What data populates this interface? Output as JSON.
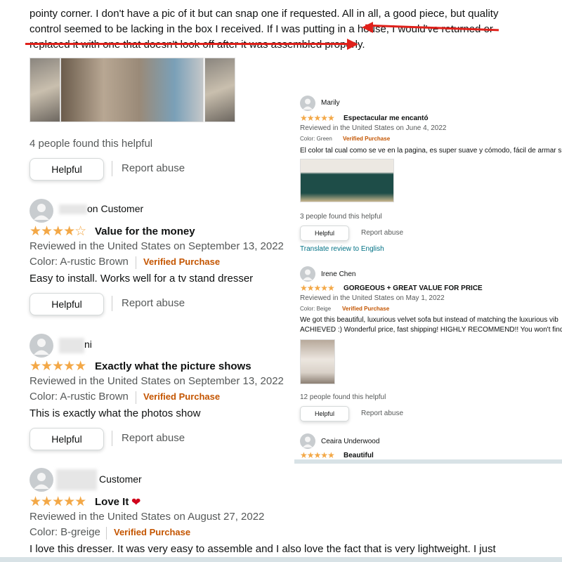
{
  "left": {
    "top_text_1": "pointy corner. I don't have a pic of it but can snap one if requested. All in all, a good piece, but quality",
    "top_text_2": "control seemed to be lacking in the box I received. If I was putting in a house, I would've returned or",
    "top_text_3": "replaced it with one that doesn't look off after it was assembled properly.",
    "helpful_count": "4 people found this helpful",
    "helpful_label": "Helpful",
    "report_label": "Report abuse",
    "reviews": [
      {
        "name": "on Customer",
        "title": "Value for the money",
        "stars": "★★★★☆",
        "date": "Reviewed in the United States on September 13, 2022",
        "color": "Color: A-rustic Brown",
        "verified": "Verified Purchase",
        "body": "Easy to install. Works well for a tv stand dresser"
      },
      {
        "name": "ni",
        "title": "Exactly what the picture shows",
        "stars": "★★★★★",
        "date": "Reviewed in the United States on September 13, 2022",
        "color": "Color: A-rustic Brown",
        "verified": "Verified Purchase",
        "body": "This is exactly what the photos show"
      },
      {
        "name": "Customer",
        "title": "Love It",
        "stars": "★★★★★",
        "date": "Reviewed in the United States on August 27, 2022",
        "color": "Color: B-greige",
        "verified": "Verified Purchase",
        "body": "I love this dresser. It was very easy to assemble and I also love the fact that is very lightweight. I just"
      }
    ]
  },
  "right": {
    "reviews": [
      {
        "name": "Marily",
        "title": "Espectacular me encantó",
        "stars": "★★★★★",
        "date": "Reviewed in the United States on June 4, 2022",
        "color": "Color: Green",
        "verified": "Verified Purchase",
        "body": "El color tal cual como se ve en la pagina, es super suave y cómodo, fácil de armar sin",
        "helpful_count": "3 people found this helpful",
        "translate": "Translate review to English"
      },
      {
        "name": "Irene Chen",
        "title": "GORGEOUS + GREAT VALUE FOR PRICE",
        "stars": "★★★★★",
        "date": "Reviewed in the United States on May 1, 2022",
        "color": "Color: Beige",
        "verified": "Verified Purchase",
        "body1": "We got this beautiful, luxurious velvet sofa but instead of matching the luxurious vib",
        "body2": "ACHIEVED :) Wonderful price, fast shipping! HIGHLY RECOMMEND!! You won't find a",
        "helpful_count": "12 people found this helpful"
      },
      {
        "name": "Ceaira Underwood",
        "title": "Beautiful",
        "stars": "★★★★★"
      }
    ],
    "helpful_label": "Helpful",
    "report_label": "Report abuse"
  },
  "colors": {
    "verified": "#c45500",
    "star": "#f3a847",
    "link": "#007185",
    "arrow": "#e0211b"
  }
}
